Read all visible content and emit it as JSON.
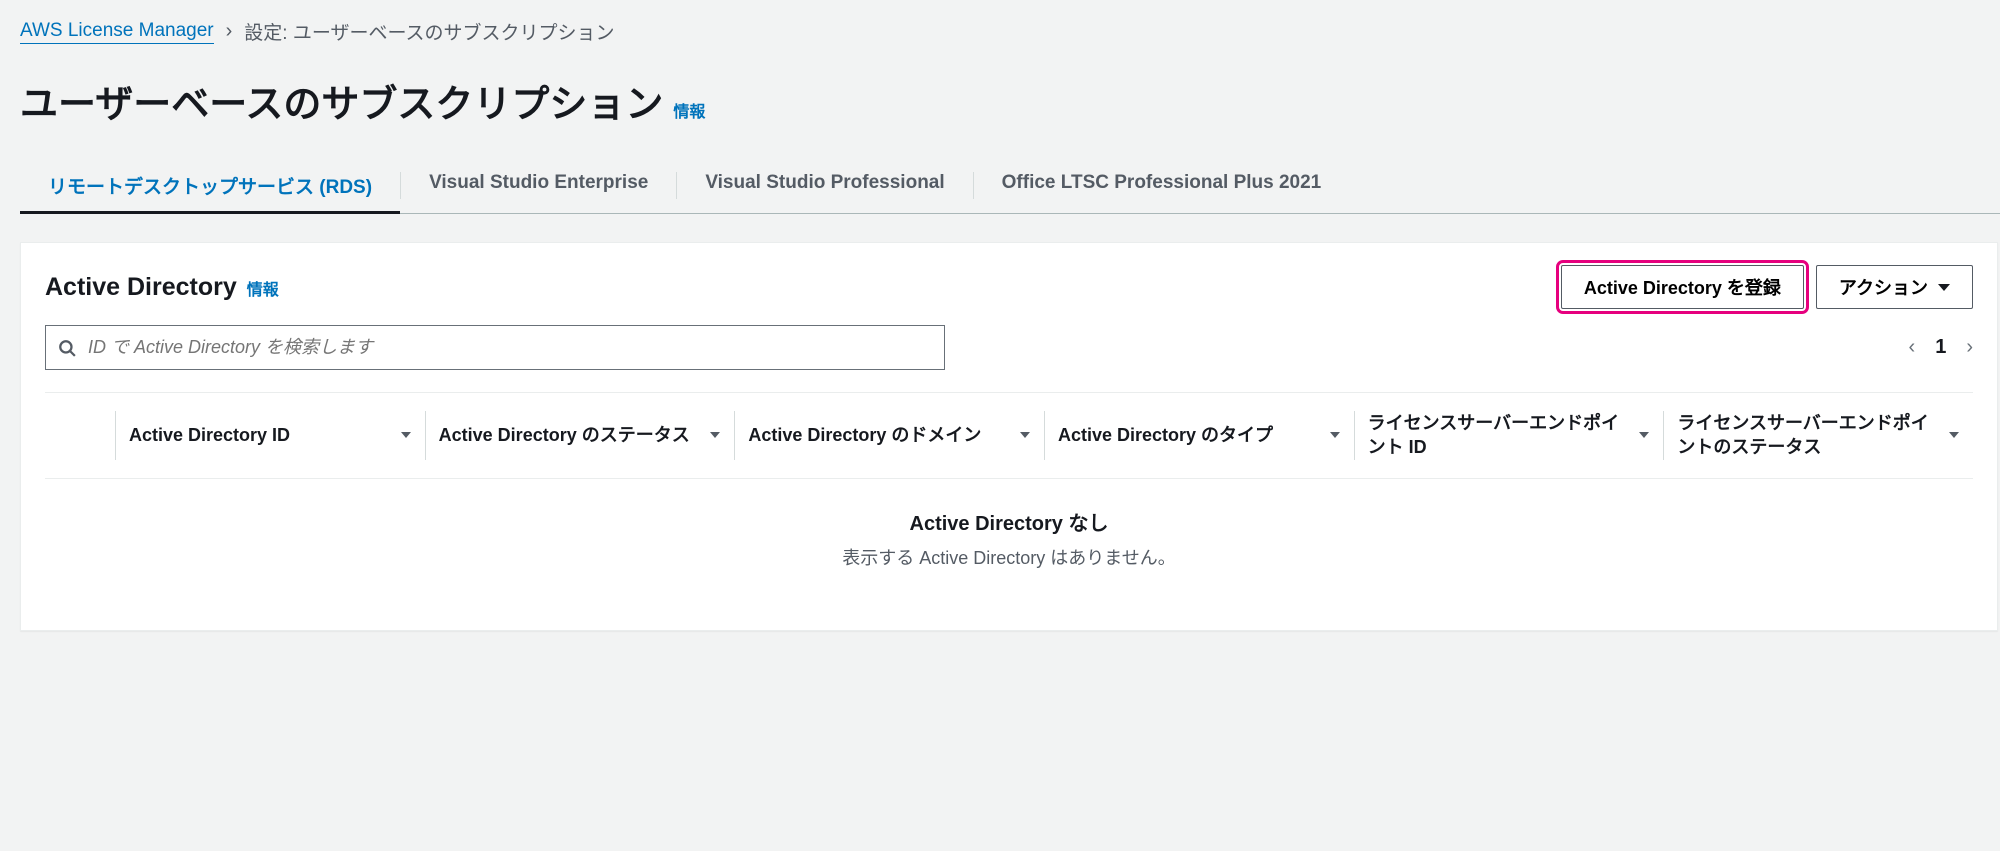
{
  "breadcrumb": {
    "root": "AWS License Manager",
    "current": "設定: ユーザーベースのサブスクリプション"
  },
  "page": {
    "title": "ユーザーベースのサブスクリプション",
    "info_label": "情報"
  },
  "tabs": [
    {
      "label": "リモートデスクトップサービス (RDS)",
      "active": true
    },
    {
      "label": "Visual Studio Enterprise",
      "active": false
    },
    {
      "label": "Visual Studio Professional",
      "active": false
    },
    {
      "label": "Office LTSC Professional Plus 2021",
      "active": false
    }
  ],
  "panel": {
    "title": "Active Directory",
    "info_label": "情報",
    "register_button": "Active Directory を登録",
    "actions_button": "アクション"
  },
  "search": {
    "placeholder": "ID で Active Directory を検索します"
  },
  "pagination": {
    "current": "1"
  },
  "columns": [
    "Active Directory ID",
    "Active Directory のステータス",
    "Active Directory のドメイン",
    "Active Directory のタイプ",
    "ライセンスサーバーエンドポイント ID",
    "ライセンスサーバーエンドポイントのステータス"
  ],
  "empty": {
    "title": "Active Directory なし",
    "subtitle": "表示する Active Directory はありません。"
  }
}
